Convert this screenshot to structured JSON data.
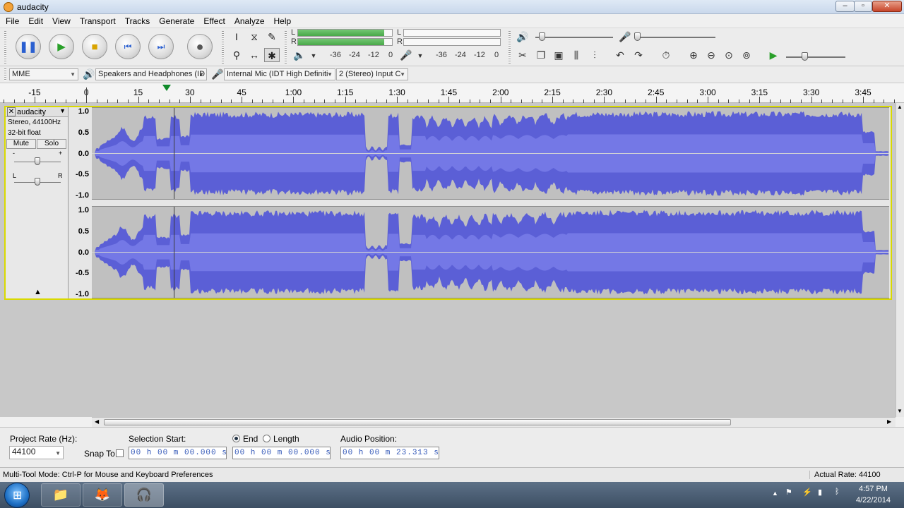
{
  "window": {
    "title": "audacity"
  },
  "menu": [
    "File",
    "Edit",
    "View",
    "Transport",
    "Tracks",
    "Generate",
    "Effect",
    "Analyze",
    "Help"
  ],
  "meters": {
    "playback_scale": [
      "-36",
      "-24",
      "-12",
      "0"
    ],
    "record_scale": [
      "-36",
      "-24",
      "-12",
      "0"
    ],
    "left_label": "L",
    "right_label": "R",
    "playback_level_left": 0.92,
    "playback_level_right": 0.92
  },
  "device": {
    "host": "MME",
    "output": "Speakers and Headphones (ID",
    "input": "Internal Mic (IDT High Definiti",
    "channels": "2 (Stereo) Input C"
  },
  "timeline": {
    "labels": [
      "-15",
      "0",
      "15",
      "30",
      "45",
      "1:00",
      "1:15",
      "1:30",
      "1:45",
      "2:00",
      "2:15",
      "2:30",
      "2:45",
      "3:00",
      "3:15",
      "3:30",
      "3:45"
    ],
    "range_seconds": [
      -25,
      234
    ],
    "playhead_seconds": 23.3
  },
  "track": {
    "name": "audacity",
    "format": "Stereo, 44100Hz",
    "sample": "32-bit float",
    "mute": "Mute",
    "solo": "Solo",
    "pan_l": "L",
    "pan_r": "R",
    "scale": [
      "1.0",
      "0.5",
      "0.0",
      "-0.5",
      "-1.0"
    ],
    "color": "#5b5fd6"
  },
  "selection_bar": {
    "project_rate_label": "Project Rate (Hz):",
    "project_rate": "44100",
    "snap_to": "Snap To",
    "selection_start_label": "Selection Start:",
    "end_label": "End",
    "length_label": "Length",
    "audio_position_label": "Audio Position:",
    "selection_start": "00 h 00 m 00.000 s",
    "selection_end": "00 h 00 m 00.000 s",
    "audio_position": "00 h 00 m 23.313 s"
  },
  "status": {
    "message": "Multi-Tool Mode: Ctrl-P for Mouse and Keyboard Preferences",
    "actual_rate": "Actual Rate: 44100"
  },
  "taskbar": {
    "time": "4:57 PM",
    "date": "4/22/2014"
  }
}
